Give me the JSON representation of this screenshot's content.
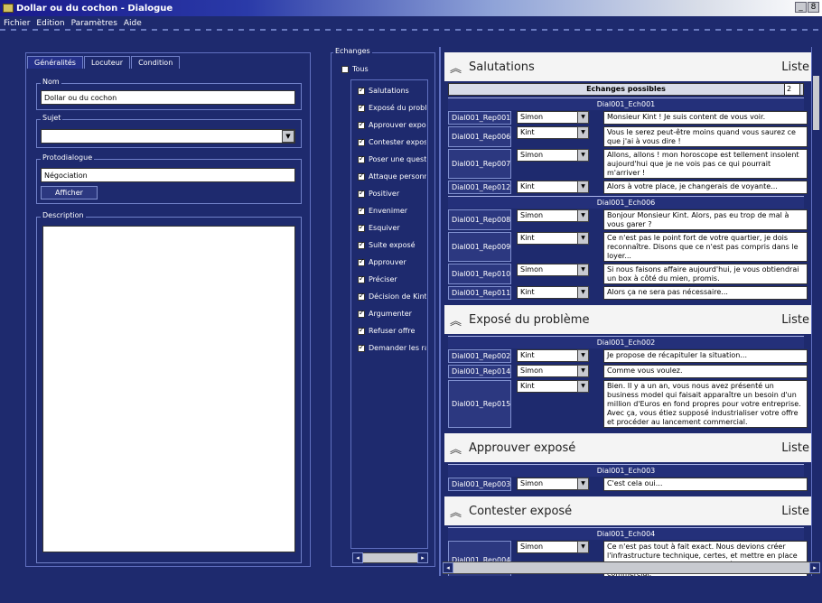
{
  "window": {
    "title": "Dollar ou du cochon - Dialogue",
    "controls": [
      "_",
      "8"
    ]
  },
  "menu": [
    "Fichier",
    "Edition",
    "Paramètres",
    "Aide"
  ],
  "left": {
    "tabs": [
      "Généralités",
      "Locuteur",
      "Condition"
    ],
    "nom": {
      "legend": "Nom",
      "value": "Dollar ou du cochon"
    },
    "sujet": {
      "legend": "Sujet",
      "value": ""
    },
    "protodialogue": {
      "legend": "Protodialogue",
      "value": "Négociation",
      "button": "Afficher"
    },
    "description": {
      "legend": "Description"
    }
  },
  "middle": {
    "legend": "Echanges",
    "tous": "Tous",
    "items": [
      "Salutations",
      "Exposé du probl",
      "Approuver expos",
      "Contester expos",
      "Poser une quest",
      "Attaque personn",
      "Positiver",
      "Envenimer",
      "Esquiver",
      "Suite exposé",
      "Approuver",
      "Préciser",
      "Décision de Kint",
      "Argumenter",
      "Refuser offre",
      "Demander les ra"
    ]
  },
  "right": {
    "liste": "Liste",
    "echanges_possibles": "Echanges possibles",
    "spin_value": "2",
    "sections": [
      {
        "title": "Salutations",
        "groups": [
          {
            "id": "Dial001_Ech001",
            "rows": [
              {
                "rep": "Dial001_Rep001",
                "speaker": "Simon",
                "text": "Monsieur Kint ! Je suis content de vous voir."
              },
              {
                "rep": "Dial001_Rep006",
                "speaker": "Kint",
                "text": "Vous le serez peut-être moins quand vous saurez ce que j'ai à vous dire !"
              },
              {
                "rep": "Dial001_Rep007",
                "speaker": "Simon",
                "text": "Allons, allons ! mon horoscope est tellement insolent aujourd'hui que je ne vois pas ce qui pourrait m'arriver !"
              },
              {
                "rep": "Dial001_Rep012",
                "speaker": "Kint",
                "text": "Alors à votre place, je changerais de voyante..."
              }
            ]
          },
          {
            "id": "Dial001_Ech006",
            "rows": [
              {
                "rep": "Dial001_Rep008",
                "speaker": "Simon",
                "text": "Bonjour Monsieur Kint. Alors, pas eu trop de mal à vous garer ?"
              },
              {
                "rep": "Dial001_Rep009",
                "speaker": "Kint",
                "text": "Ce n'est pas le point fort de votre quartier, je dois reconnaître. Disons que ce n'est pas compris dans le loyer..."
              },
              {
                "rep": "Dial001_Rep010",
                "speaker": "Simon",
                "text": "Si nous faisons affaire aujourd'hui, je vous obtiendrai un box à côté du mien, promis."
              },
              {
                "rep": "Dial001_Rep011",
                "speaker": "Kint",
                "text": "Alors ça ne sera pas nécessaire..."
              }
            ]
          }
        ]
      },
      {
        "title": "Exposé du problème",
        "groups": [
          {
            "id": "Dial001_Ech002",
            "rows": [
              {
                "rep": "Dial001_Rep002",
                "speaker": "Kint",
                "text": "Je propose de récapituler la situation..."
              },
              {
                "rep": "Dial001_Rep014",
                "speaker": "Simon",
                "text": "Comme vous voulez."
              },
              {
                "rep": "Dial001_Rep015",
                "speaker": "Kint",
                "text": "Bien. Il y a un an, vous nous avez présenté un business model qui faisait apparaître un besoin d'un million d'Euros en fond propres pour votre entreprise. Avec ça, vous étiez supposé industrialiser votre offre et procéder au lancement commercial."
              }
            ]
          }
        ]
      },
      {
        "title": "Approuver exposé",
        "groups": [
          {
            "id": "Dial001_Ech003",
            "rows": [
              {
                "rep": "Dial001_Rep003",
                "speaker": "Simon",
                "text": "C'est cela oui..."
              }
            ]
          }
        ]
      },
      {
        "title": "Contester exposé",
        "groups": [
          {
            "id": "Dial001_Ech004",
            "rows": [
              {
                "rep": "Dial001_Rep004",
                "speaker": "Simon",
                "text": "Ce n'est pas tout à fait exact. Nous devions créer l'infrastructure technique, certes, et mettre en place le plan marketing. Je n'ai pas parlé de lancement commercial."
              }
            ]
          }
        ]
      }
    ]
  }
}
